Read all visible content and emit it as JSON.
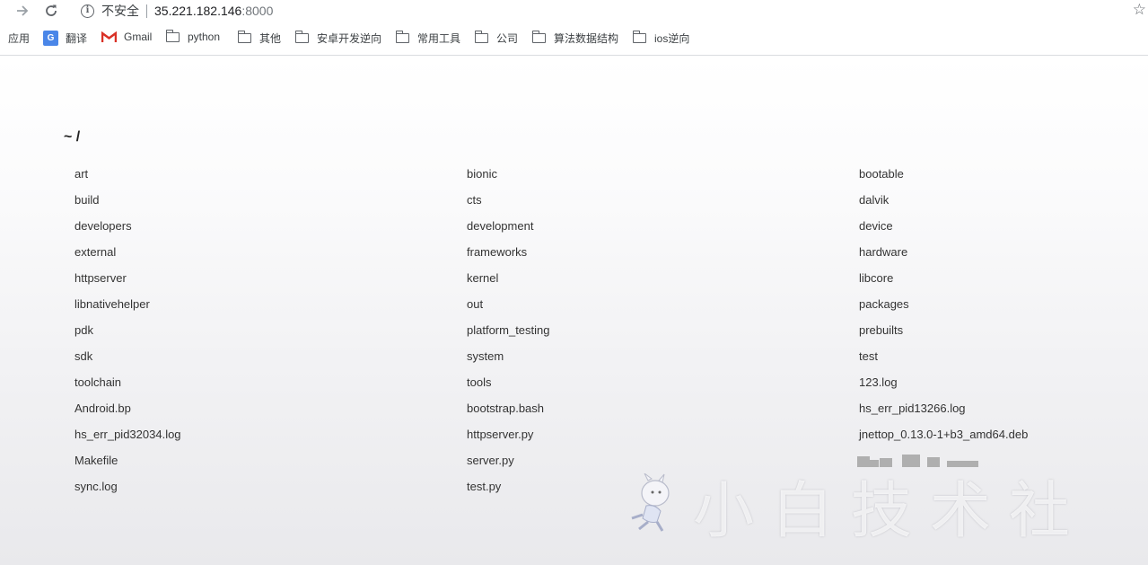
{
  "browser": {
    "security_label": "不安全",
    "url_host": "35.221.182.146",
    "url_port": ":8000",
    "bookmarks": [
      {
        "label": "应用",
        "icon": "apps-icon"
      },
      {
        "label": "翻译",
        "icon": "google-translate-icon"
      },
      {
        "label": "Gmail",
        "icon": "gmail-icon"
      },
      {
        "label": "python",
        "icon": "folder-icon"
      },
      {
        "label": "其他",
        "icon": "folder-icon"
      },
      {
        "label": "安卓开发逆向",
        "icon": "folder-icon"
      },
      {
        "label": "常用工具",
        "icon": "folder-icon"
      },
      {
        "label": "公司",
        "icon": "folder-icon"
      },
      {
        "label": "算法数据结构",
        "icon": "folder-icon"
      },
      {
        "label": "ios逆向",
        "icon": "folder-icon"
      }
    ]
  },
  "page": {
    "heading": "~ /",
    "items": [
      "art",
      "bionic",
      "bootable",
      "build",
      "cts",
      "dalvik",
      "developers",
      "development",
      "device",
      "external",
      "frameworks",
      "hardware",
      "httpserver",
      "kernel",
      "libcore",
      "libnativehelper",
      "out",
      "packages",
      "pdk",
      "platform_testing",
      "prebuilts",
      "sdk",
      "system",
      "test",
      "toolchain",
      "tools",
      "123.log",
      "Android.bp",
      "bootstrap.bash",
      "hs_err_pid13266.log",
      "hs_err_pid32034.log",
      "httpserver.py",
      "jnettop_0.13.0-1+b3_amd64.deb",
      "Makefile",
      "server.py",
      "",
      "sync.log",
      "test.py",
      ""
    ]
  },
  "watermark": {
    "text": "小白技术社"
  }
}
